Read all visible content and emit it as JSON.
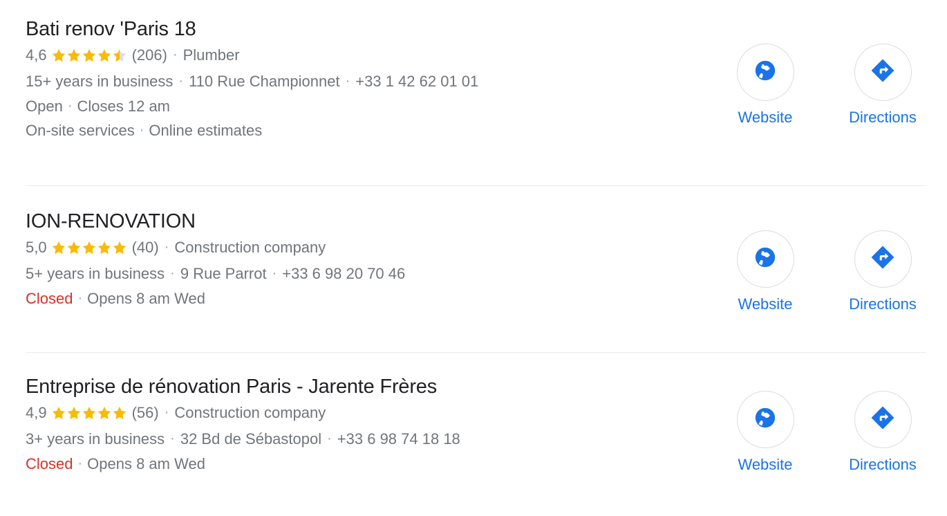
{
  "page": {
    "background": "#ffffff",
    "link_color": "#1a73e8",
    "title_color": "#202124",
    "body_color": "#70757a",
    "closed_color": "#d93025",
    "star_color": "#fabb05",
    "star_empty_color": "#dadce0",
    "divider_color": "#ebebeb",
    "separator_dot": "·"
  },
  "actions": {
    "website": {
      "label": "Website",
      "icon": "globe-icon"
    },
    "directions": {
      "label": "Directions",
      "icon": "directions-diamond-icon"
    }
  },
  "listings": [
    {
      "name": "Bati renov 'Paris 18",
      "rating": "4,6",
      "stars_filled": 4,
      "stars_half": 1,
      "review_count": "(206)",
      "category": "Plumber",
      "years_in_business": "15+ years in business",
      "address": "110 Rue Championnet",
      "phone": "+33 1 42 62 01 01",
      "status": "Open",
      "status_state": "open",
      "hours": "Closes 12 am",
      "services": [
        "On-site services",
        "Online estimates"
      ]
    },
    {
      "name": "ION-RENOVATION",
      "rating": "5,0",
      "stars_filled": 5,
      "stars_half": 0,
      "review_count": "(40)",
      "category": "Construction company",
      "years_in_business": "5+ years in business",
      "address": "9 Rue Parrot",
      "phone": "+33 6 98 20 70 46",
      "status": "Closed",
      "status_state": "closed",
      "hours": "Opens 8 am Wed",
      "services": []
    },
    {
      "name": "Entreprise de rénovation Paris - Jarente Frères",
      "rating": "4,9",
      "stars_filled": 5,
      "stars_half": 0,
      "review_count": "(56)",
      "category": "Construction company",
      "years_in_business": "3+ years in business",
      "address": "32 Bd de Sébastopol",
      "phone": "+33 6 98 74 18 18",
      "status": "Closed",
      "status_state": "closed",
      "hours": "Opens 8 am Wed",
      "services": []
    }
  ]
}
